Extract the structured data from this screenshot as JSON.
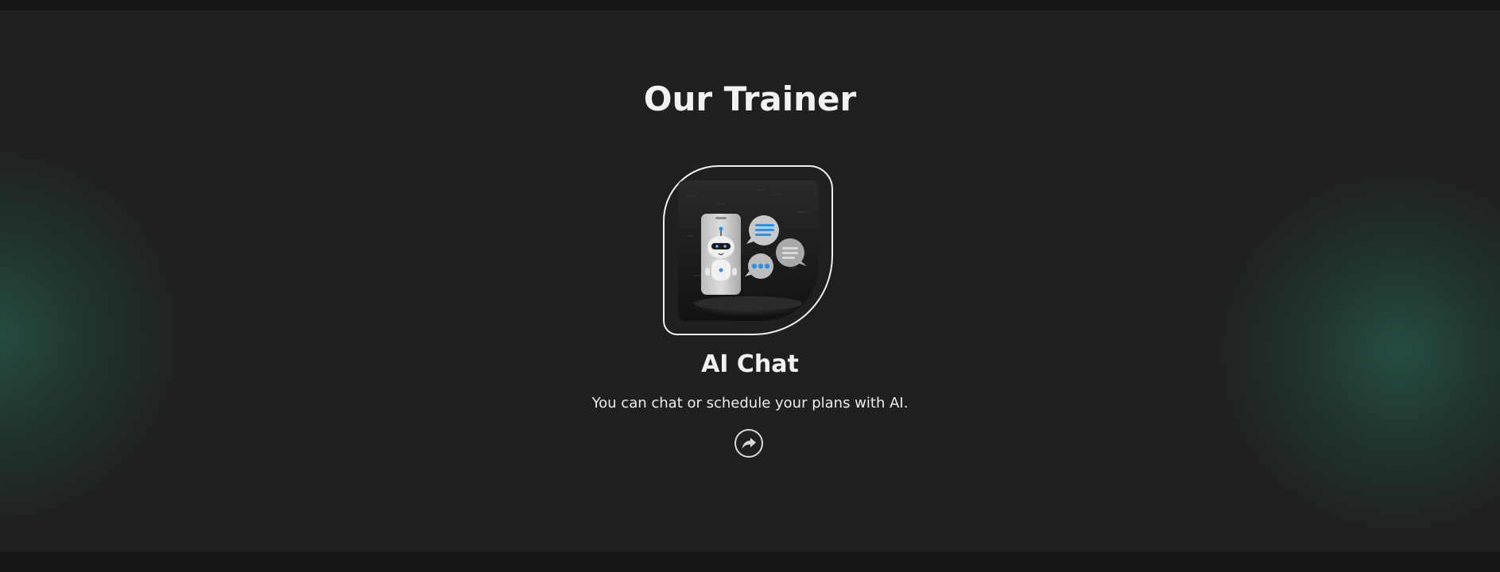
{
  "section": {
    "title": "Our Trainer"
  },
  "trainer_card": {
    "image_icon": "ai-chatbot-illustration",
    "title": "AI Chat",
    "description": "You can chat or schedule your plans with AI.",
    "action_icon": "share-arrow-icon"
  },
  "colors": {
    "background": "#1f2120",
    "page_edge": "#161817",
    "glow": "#265c4e",
    "text": "#f2f2f2",
    "accent_blue": "#2e8fe6"
  }
}
